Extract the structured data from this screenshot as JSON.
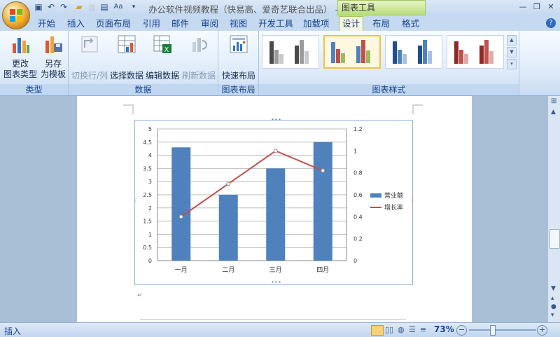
{
  "window": {
    "title": "办公软件视频教程（快易高、爱奇艺联合出品） -",
    "context_tab": "图表工具"
  },
  "tabs": [
    "开始",
    "插入",
    "页面布局",
    "引用",
    "邮件",
    "审阅",
    "视图",
    "开发工具",
    "加载项",
    "设计",
    "布局",
    "格式"
  ],
  "active_tab": "设计",
  "ribbon": {
    "group_type": {
      "label": "类型",
      "change_type_l1": "更改",
      "change_type_l2": "图表类型",
      "save_template_l1": "另存",
      "save_template_l2": "为模板"
    },
    "group_data": {
      "label": "数据",
      "switch_row_col": "切换行/列",
      "select_data": "选择数据",
      "edit_data": "编辑数据",
      "refresh_data": "刷新数据"
    },
    "group_layout": {
      "label": "图表布局",
      "quick_layout": "快速布局"
    },
    "group_styles": {
      "label": "图表样式"
    }
  },
  "chart_data": {
    "type": "bar",
    "categories": [
      "一月",
      "二月",
      "三月",
      "四月"
    ],
    "series": [
      {
        "name": "营业额",
        "type": "bar",
        "axis": "left",
        "values": [
          4.3,
          2.5,
          3.5,
          4.5
        ],
        "color": "#4f81bd"
      },
      {
        "name": "增长率",
        "type": "line",
        "axis": "right",
        "values": [
          0.4,
          0.7,
          1.0,
          0.82
        ],
        "color": "#c0504d"
      }
    ],
    "ylim": [
      0,
      5
    ],
    "yticks": [
      "0",
      "0.5",
      "1",
      "1.5",
      "2",
      "2.5",
      "3",
      "3.5",
      "4",
      "4.5",
      "5"
    ],
    "y2lim": [
      0,
      1.2
    ],
    "y2ticks": [
      "0",
      "0.2",
      "0.4",
      "0.6",
      "0.8",
      "1",
      "1.2"
    ],
    "grid": true,
    "legend": "right"
  },
  "status": {
    "mode": "插入",
    "zoom": "73%"
  },
  "colors": {
    "accent": "#4f81bd",
    "line": "#c0504d",
    "ribbon": "#dbe7f6"
  }
}
